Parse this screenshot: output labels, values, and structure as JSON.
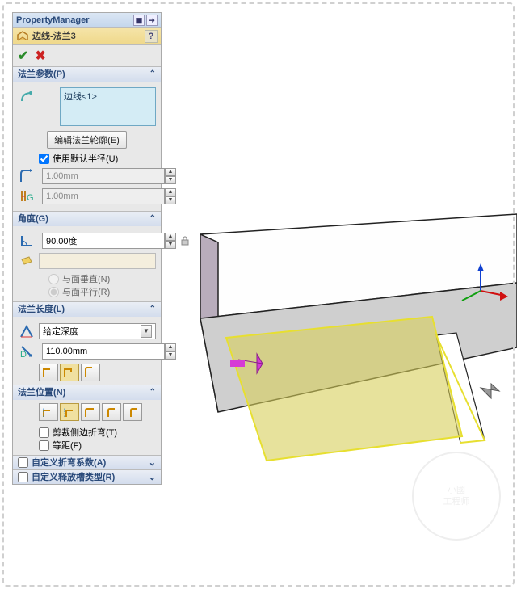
{
  "header": {
    "title": "PropertyManager"
  },
  "feature": {
    "title": "边线-法兰3"
  },
  "params": {
    "title": "法兰参数(P)",
    "edge_selection": "边线<1>",
    "edit_profile_btn": "编辑法兰轮廓(E)",
    "use_default_radius_label": "使用默认半径(U)",
    "use_default_radius_checked": true,
    "bend_radius": "1.00mm",
    "gap": "1.00mm"
  },
  "angle": {
    "title": "角度(G)",
    "value": "90.00度",
    "perpendicular_label": "与面垂直(N)",
    "parallel_label": "与面平行(R)",
    "selected": "parallel"
  },
  "length": {
    "title": "法兰长度(L)",
    "end_condition": "给定深度",
    "value": "110.00mm"
  },
  "position": {
    "title": "法兰位置(N)",
    "trim_side_bends_label": "剪裁侧边折弯(T)",
    "trim_side_bends_checked": false,
    "offset_label": "等距(F)",
    "offset_checked": false
  },
  "collapsed": {
    "custom_bend_allowance": "自定义折弯系数(A)",
    "custom_relief": "自定义释放槽类型(R)"
  },
  "watermark": {
    "line1": "小國",
    "line2": "工程师"
  }
}
